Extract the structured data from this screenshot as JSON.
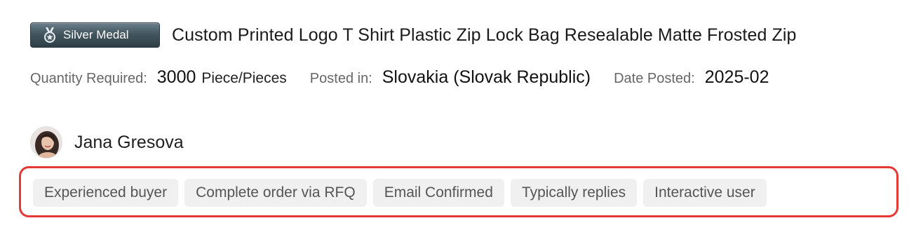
{
  "listing": {
    "medal_label": "Silver Medal",
    "title": "Custom Printed Logo T Shirt Plastic Zip Lock Bag Resealable Matte Frosted Zip"
  },
  "meta": {
    "quantity_label": "Quantity Required:",
    "quantity_value": "3000",
    "quantity_unit": "Piece/Pieces",
    "posted_in_label": "Posted in:",
    "posted_in_value": "Slovakia (Slovak Republic)",
    "date_label": "Date Posted:",
    "date_value": "2025-02"
  },
  "buyer": {
    "name": "Jana Gresova"
  },
  "tags": [
    "Experienced buyer",
    "Complete order via RFQ",
    "Email Confirmed",
    "Typically replies",
    "Interactive user"
  ],
  "colors": {
    "highlight_border": "#e53935",
    "tag_background": "#f0f0f0",
    "medal_dark": "#2e3e46"
  }
}
